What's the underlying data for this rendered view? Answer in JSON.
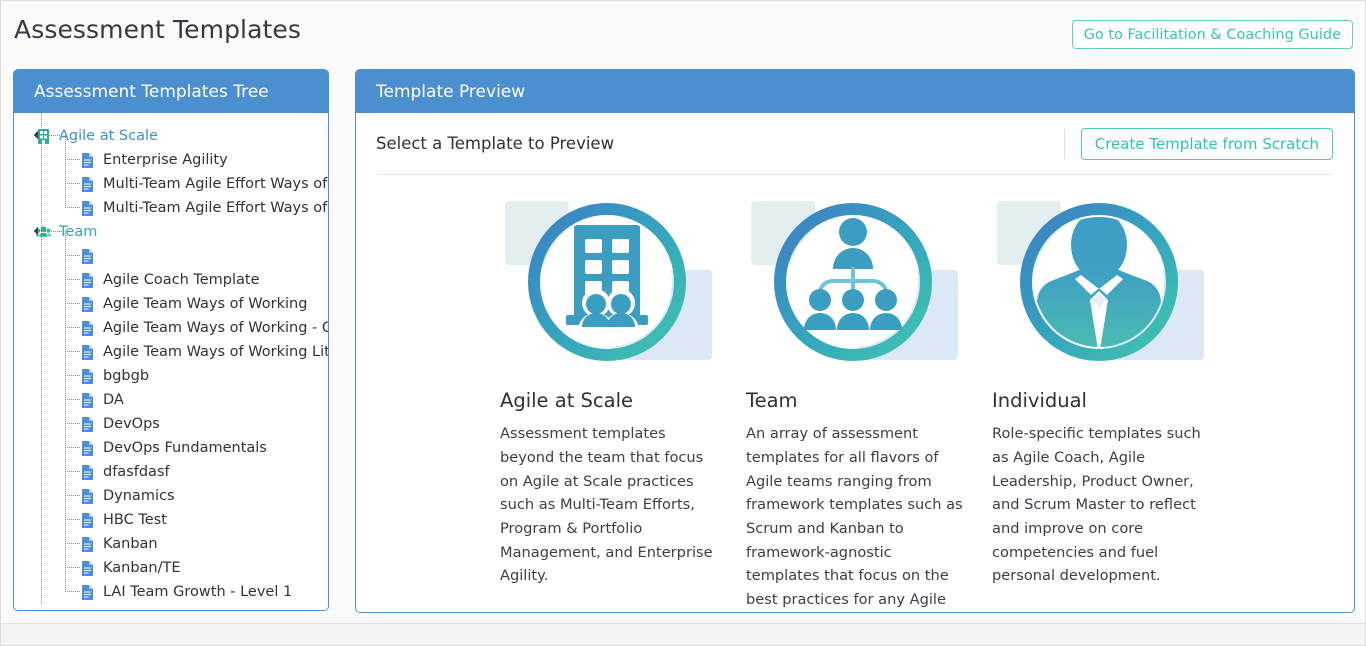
{
  "header": {
    "title": "Assessment Templates",
    "guide_button": "Go to Facilitation & Coaching Guide"
  },
  "tree_panel": {
    "title": "Assessment Templates Tree",
    "nodes": [
      {
        "label": "Agile at Scale",
        "type": "group",
        "icon": "building-icon",
        "color": "#3c8fd4"
      },
      {
        "label": "Enterprise Agility",
        "type": "item",
        "icon": "document-icon"
      },
      {
        "label": "Multi-Team Agile Effort Ways of Wor",
        "type": "item",
        "icon": "document-icon"
      },
      {
        "label": "Multi-Team Agile Effort Ways of Wor",
        "type": "item",
        "icon": "document-icon"
      },
      {
        "label": "Team",
        "type": "group",
        "icon": "people-group-icon",
        "color": "#2fa9b6"
      },
      {
        "label": "",
        "type": "item",
        "icon": "document-icon"
      },
      {
        "label": "Agile Coach Template",
        "type": "item",
        "icon": "document-icon"
      },
      {
        "label": "Agile Team Ways of Working",
        "type": "item",
        "icon": "document-icon"
      },
      {
        "label": "Agile Team Ways of Working - Custo",
        "type": "item",
        "icon": "document-icon"
      },
      {
        "label": "Agile Team Ways of Working Lite",
        "type": "item",
        "icon": "document-icon"
      },
      {
        "label": "bgbgb",
        "type": "item",
        "icon": "document-icon"
      },
      {
        "label": "DA",
        "type": "item",
        "icon": "document-icon"
      },
      {
        "label": "DevOps",
        "type": "item",
        "icon": "document-icon"
      },
      {
        "label": "DevOps Fundamentals",
        "type": "item",
        "icon": "document-icon"
      },
      {
        "label": "dfasfdasf",
        "type": "item",
        "icon": "document-icon"
      },
      {
        "label": "Dynamics",
        "type": "item",
        "icon": "document-icon"
      },
      {
        "label": "HBC Test",
        "type": "item",
        "icon": "document-icon"
      },
      {
        "label": "Kanban",
        "type": "item",
        "icon": "document-icon"
      },
      {
        "label": "Kanban/TE",
        "type": "item",
        "icon": "document-icon"
      },
      {
        "label": "LAI Team Growth - Level 1",
        "type": "item",
        "icon": "document-icon"
      }
    ]
  },
  "preview_panel": {
    "title": "Template Preview",
    "toolbar_label": "Select a Template to Preview",
    "scratch_button": "Create Template from Scratch",
    "cards": [
      {
        "title": "Agile at Scale",
        "icon": "building-with-people-icon",
        "description": "Assessment templates beyond the team that focus on Agile at Scale practices such as Multi-Team Efforts, Program & Portfolio Management, and Enterprise Agility."
      },
      {
        "title": "Team",
        "icon": "org-chart-team-icon",
        "description": "An array of assessment templates for all flavors of Agile teams ranging from framework templates such as Scrum and Kanban to framework-agnostic templates that focus on the best practices for any Agile team."
      },
      {
        "title": "Individual",
        "icon": "person-in-suit-icon",
        "description": "Role-specific templates such as Agile Coach, Agile Leadership, Product Owner, and Scrum Master to reflect and improve on core competencies and fuel personal development."
      }
    ]
  },
  "colors": {
    "panel_header_blue": "#4b8fd0",
    "accent_teal": "#3cc3b4",
    "tree_group_blue": "#3c8fd4",
    "tree_group_teal": "#2fa9b6",
    "page_background": "#fafafa"
  }
}
